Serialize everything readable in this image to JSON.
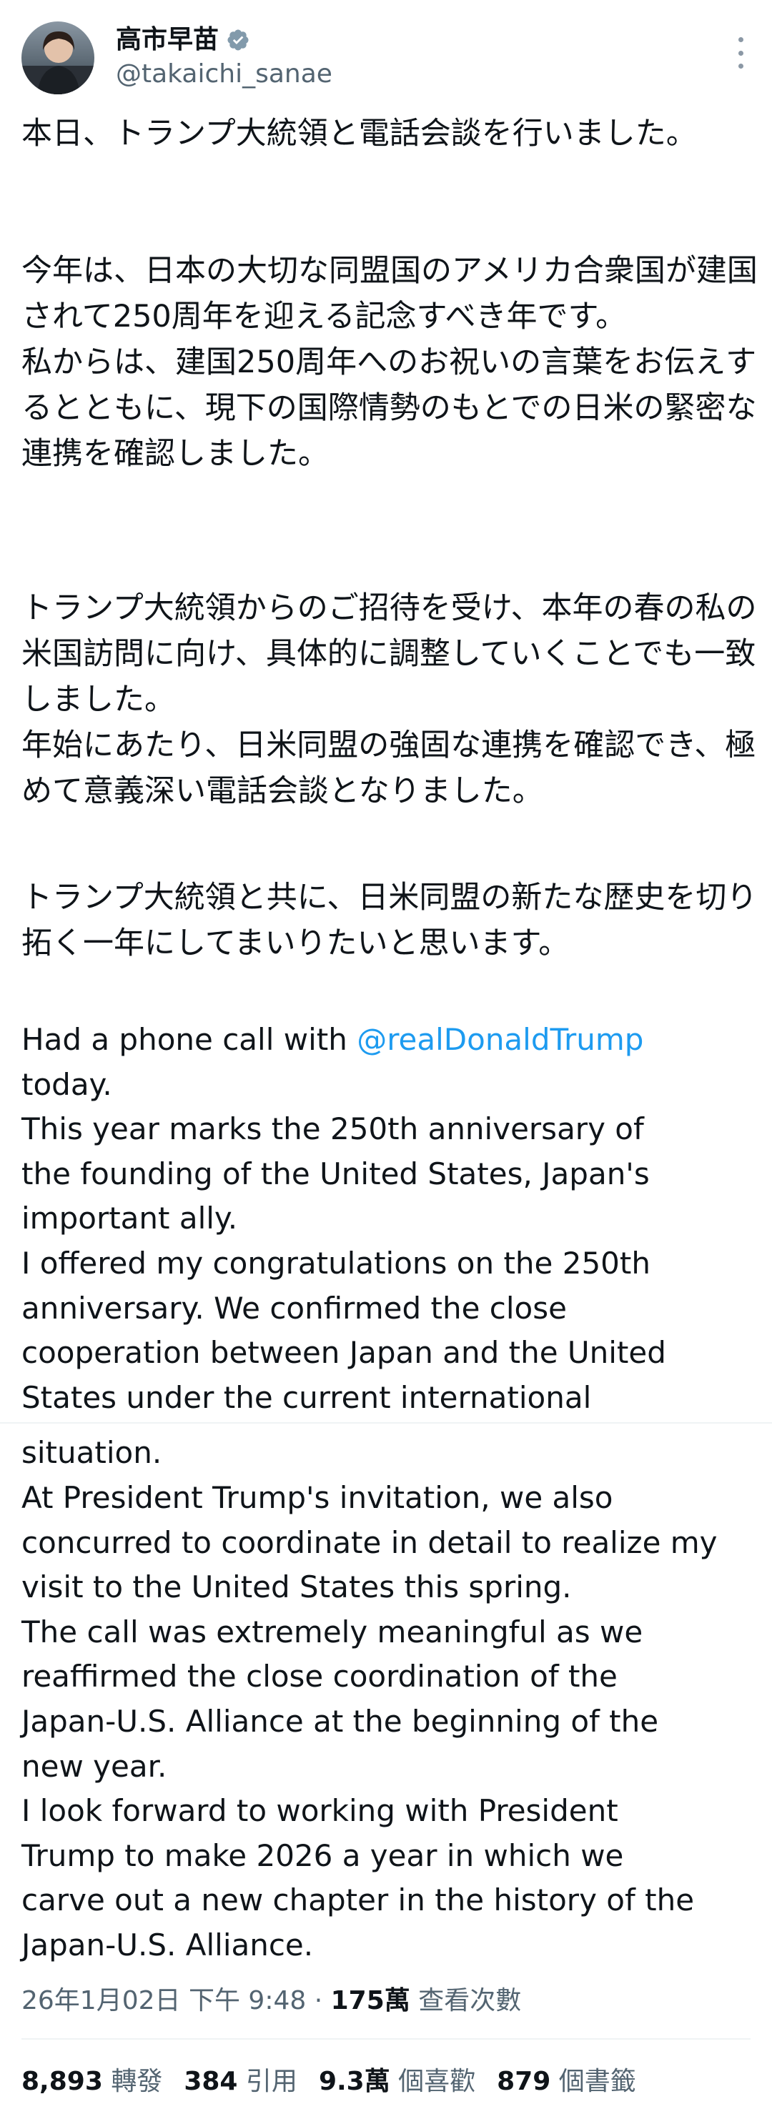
{
  "author": {
    "name": "高市早苗",
    "handle": "@takaichi_sanae"
  },
  "tweet": {
    "jp_paragraphs": [
      "本日、トランプ大統領と電話会談を行いました。",
      "今年は、日本の大切な同盟国のアメリカ合衆国が建国されて250周年を迎える記念すべき年です。\n私からは、建国250周年へのお祝いの言葉をお伝えするとともに、現下の国際情勢のもとでの日米の緊密な連携を確認しました。",
      "トランプ大統領からのご招待を受け、本年の春の私の米国訪問に向け、具体的に調整していくことでも一致しました。\n年始にあたり、日米同盟の強固な連携を確認でき、極めて意義深い電話会談となりました。",
      "トランプ大統領と共に、日米同盟の新たな歴史を切り拓く一年にしてまいりたいと思います。"
    ],
    "en_first_prefix": "Had a phone call with ",
    "mention": "@realDonaldTrump",
    "en_lines": [
      "today.",
      "This year marks the 250th anniversary of",
      "the founding of the United States, Japan's",
      "important ally.",
      "I offered my congratulations on the 250th",
      "anniversary. We confirmed the close",
      "cooperation between Japan and the United",
      "States under the current international",
      "situation.",
      "At President Trump's invitation, we also",
      "concurred to coordinate in detail to realize my",
      "visit to the United States this spring.",
      "The call was extremely meaningful as we",
      "reaffirmed the close coordination of the",
      "Japan-U.S. Alliance at the beginning of the",
      "new year.",
      "I look forward to working with President",
      "Trump to make 2026 a year in which we",
      "carve out a new chapter in the history of the",
      "Japan-U.S. Alliance."
    ]
  },
  "meta": {
    "date_time": "26年1月02日 下午 9:48",
    "separator": " · ",
    "views_count": "175萬",
    "views_label": " 查看次數"
  },
  "stats": {
    "retweets_count": "8,893",
    "retweets_label": " 轉發",
    "quotes_count": "384",
    "quotes_label": " 引用",
    "likes_count": "9.3萬",
    "likes_label": " 個喜歡",
    "bookmarks_count": "879",
    "bookmarks_label": " 個書籤"
  },
  "colors": {
    "text": "#0f1419",
    "secondary": "#536471",
    "link": "#1d9bf0",
    "verified": "#829aab"
  },
  "icons": [
    "avatar",
    "verified-badge-icon",
    "more-options-icon"
  ]
}
